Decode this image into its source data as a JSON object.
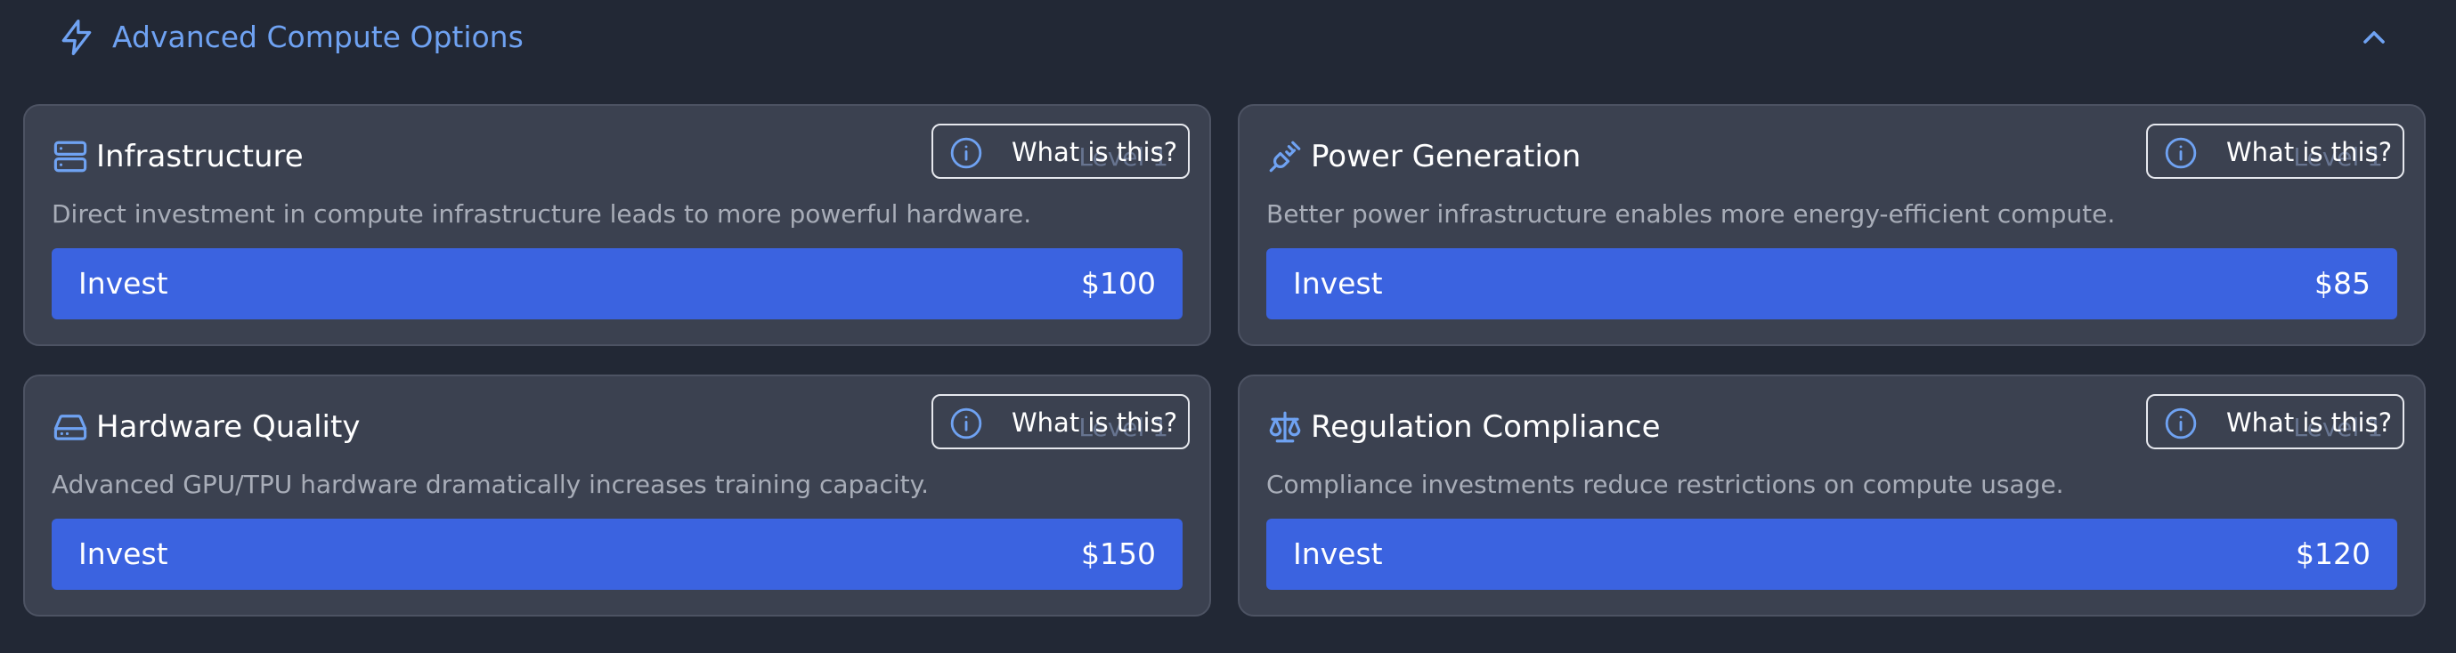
{
  "header": {
    "title": "Advanced Compute Options",
    "icon": "bolt-icon",
    "collapse_icon": "chevron-up-icon",
    "accent_color": "#6fa2f2"
  },
  "colors": {
    "background": "#222835",
    "card": "#3b4150",
    "invest_button": "#3b63e0",
    "description": "#a8adb8"
  },
  "cards": [
    {
      "title": "Infrastructure",
      "icon": "server-icon",
      "description": "Direct investment in compute infrastructure leads to more powerful hardware.",
      "info_label": "What is this?",
      "level_label": "Level 1",
      "invest_label": "Invest",
      "cost": "$100"
    },
    {
      "title": "Power Generation",
      "icon": "plug-icon",
      "description": "Better power infrastructure enables more energy-efficient compute.",
      "info_label": "What is this?",
      "level_label": "Level 1",
      "invest_label": "Invest",
      "cost": "$85"
    },
    {
      "title": "Hardware Quality",
      "icon": "hard-drive-icon",
      "description": "Advanced GPU/TPU hardware dramatically increases training capacity.",
      "info_label": "What is this?",
      "level_label": "Level 1",
      "invest_label": "Invest",
      "cost": "$150"
    },
    {
      "title": "Regulation Compliance",
      "icon": "scale-icon",
      "description": "Compliance investments reduce restrictions on compute usage.",
      "info_label": "What is this?",
      "level_label": "Level 1",
      "invest_label": "Invest",
      "cost": "$120"
    }
  ]
}
